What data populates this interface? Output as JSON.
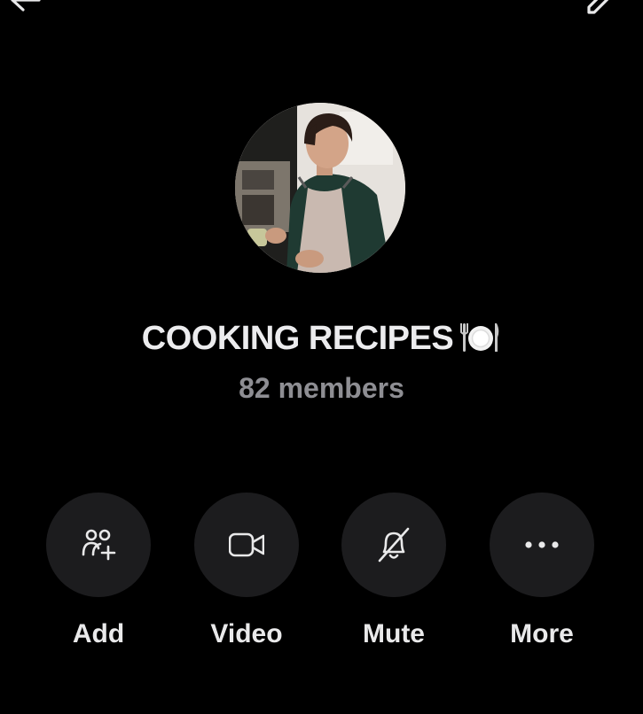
{
  "header": {
    "back_icon": "back-arrow-icon",
    "edit_icon": "pencil-icon"
  },
  "group": {
    "name": "COOKING RECIPES",
    "emoji_icon": "fork-knife-plate-icon",
    "members": "82 members",
    "avatar": "group-photo-person-in-apron"
  },
  "actions": [
    {
      "label": "Add",
      "icon": "add-person-icon"
    },
    {
      "label": "Video",
      "icon": "video-camera-icon"
    },
    {
      "label": "Mute",
      "icon": "bell-slash-icon"
    },
    {
      "label": "More",
      "icon": "ellipsis-icon"
    }
  ],
  "colors": {
    "background": "#000000",
    "button_bg": "#1c1c1e",
    "primary_text": "#e9e9ea",
    "secondary_text": "#8e8e93"
  }
}
